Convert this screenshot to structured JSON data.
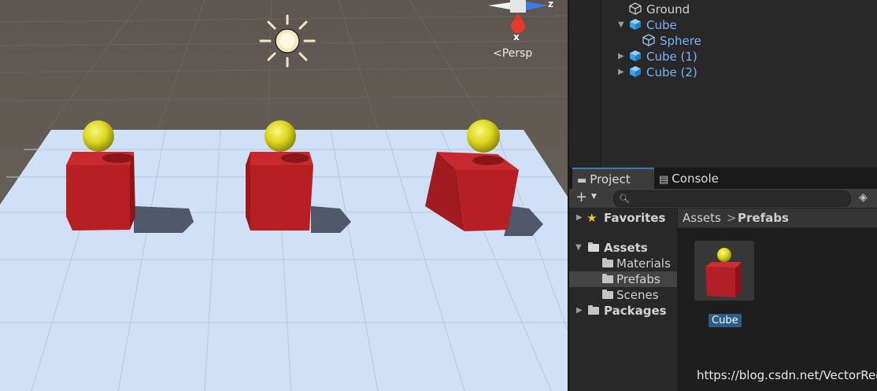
{
  "scene": {
    "projection_label": "<Persp",
    "gizmo": {
      "x_label": "x",
      "z_label": "z"
    }
  },
  "hierarchy": {
    "items": [
      {
        "label": "Ground",
        "prefab": false
      },
      {
        "label": "Cube",
        "prefab": true,
        "expanded": true
      },
      {
        "label": "Sphere",
        "prefab": true
      },
      {
        "label": "Cube (1)",
        "prefab": true,
        "expanded": false
      },
      {
        "label": "Cube (2)",
        "prefab": true,
        "expanded": false
      }
    ]
  },
  "project": {
    "tabs": [
      {
        "label": "Project",
        "icon": "folder-icon",
        "active": true
      },
      {
        "label": "Console",
        "icon": "console-icon",
        "active": false
      }
    ],
    "search_placeholder": "",
    "tree": {
      "favorites": "Favorites",
      "assets": "Assets",
      "asset_folders": [
        "Materials",
        "Prefabs",
        "Scenes"
      ],
      "packages": "Packages",
      "selected": "Prefabs"
    },
    "breadcrumb": [
      "Assets",
      "Prefabs"
    ],
    "breadcrumb_separator": ">",
    "assets": [
      {
        "label": "Cube"
      }
    ]
  },
  "colors": {
    "accent_blue": "#3a79bb",
    "prefab_text": "#7bb1f5",
    "cube_red": "#c0202a",
    "sphere_yellow": "#e6e020",
    "plane": "#cfe0f7",
    "sky": "#645c54"
  },
  "watermark": "https://blog.csdn.net/VectorRed"
}
